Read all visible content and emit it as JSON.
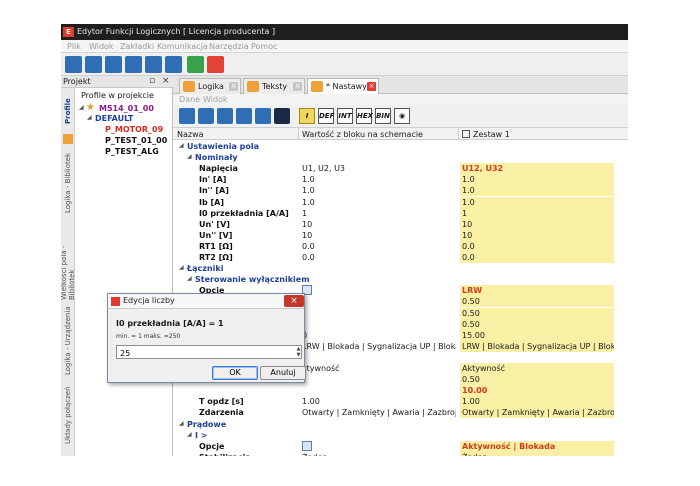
{
  "window": {
    "title": "Edytor Funkcji Logicznych [ Licencja producenta ]"
  },
  "menu": [
    "Plik",
    "Widok",
    "Zakładki",
    "Komunikacja",
    "Narzędzia",
    "Pomoc"
  ],
  "left_panel": {
    "title": "Projekt",
    "section": "Profile w projekcie",
    "vertical_tabs": [
      "Profile",
      "Logika - Bibliotek",
      "Wielkości pola - Bibliotek",
      "Logika - Urządzenia",
      "Układy połączeń"
    ],
    "tree": [
      {
        "label": "M514_01_00",
        "color": "#8b1a8b"
      },
      {
        "label": "DEFAULT",
        "color": "#1f3f99"
      },
      {
        "label": "P_MOTOR_09",
        "color": "#d52b1e"
      },
      {
        "label": "P_TEST_01_00",
        "color": "#111111"
      },
      {
        "label": "P_TEST_ALG",
        "color": "#111111"
      }
    ]
  },
  "doc_tabs": [
    {
      "label": "Logika",
      "active": false
    },
    {
      "label": "Teksty",
      "active": false
    },
    {
      "label": "* Nastawy",
      "active": true
    }
  ],
  "submenu": [
    "Dane",
    "Widok"
  ],
  "format_buttons": [
    "I",
    "DEF",
    "INT",
    "HEX",
    "BIN"
  ],
  "grid": {
    "columns": [
      "Nazwa",
      "Wartość z bloku na schemacie",
      "Zestaw 1"
    ],
    "rows": [
      {
        "level": 0,
        "name": "Ustawienia pola",
        "kind": "group"
      },
      {
        "level": 1,
        "name": "Nominały",
        "kind": "group"
      },
      {
        "level": 2,
        "name": "Napięcia",
        "value": "U1, U2, U3",
        "set": "U12, U32",
        "changed": true
      },
      {
        "level": 2,
        "name": "In' [A]",
        "value": "1.0",
        "set": "1.0"
      },
      {
        "level": 2,
        "name": "In'' [A]",
        "value": "1.0",
        "set": "1.0"
      },
      {
        "level": 2,
        "name": "Ib [A]",
        "value": "1.0",
        "set": "1.0"
      },
      {
        "level": 2,
        "name": "I0 przekładnia [A/A]",
        "value": "1",
        "set": "1"
      },
      {
        "level": 2,
        "name": "Un' [V]",
        "value": "10",
        "set": "10"
      },
      {
        "level": 2,
        "name": "Un'' [V]",
        "value": "10",
        "set": "10"
      },
      {
        "level": 2,
        "name": "RT1 [Ω]",
        "value": "0.0",
        "set": "0.0"
      },
      {
        "level": 2,
        "name": "RT2 [Ω]",
        "value": "0.0",
        "set": "0.0"
      },
      {
        "level": 0,
        "name": "Łączniki",
        "kind": "group"
      },
      {
        "level": 1,
        "name": "Sterowanie wyłącznikiem",
        "kind": "group"
      },
      {
        "level": 2,
        "name": "Opcje",
        "icon": true,
        "set": "LRW",
        "changed": true
      },
      {
        "level": 2,
        "name": "",
        "value": "",
        "set": "0.50"
      },
      {
        "level": 2,
        "name": "",
        "value": "",
        "set": "0.50"
      },
      {
        "level": 2,
        "name": "",
        "value": "",
        "set": "0.50"
      },
      {
        "level": 2,
        "name": "",
        "value": "0",
        "set": "15.00"
      },
      {
        "level": 2,
        "name": "",
        "value": "LRW | Blokada | Sygnalizacja UP | Blokada zał...",
        "set": "LRW | Blokada | Sygnalizacja UP | Blokada zał..."
      },
      {
        "level": 2,
        "name": "",
        "value": "",
        "set": ""
      },
      {
        "level": 2,
        "name": "",
        "value": "ktywność",
        "set": "Aktywność"
      },
      {
        "level": 2,
        "name": "",
        "value": "",
        "set": "0.50"
      },
      {
        "level": 2,
        "name": "",
        "value": "",
        "set": "10.00",
        "changed": true
      },
      {
        "level": 2,
        "name": "T opdz [s]",
        "value": "1.00",
        "set": "1.00"
      },
      {
        "level": 2,
        "name": "Zdarzenia",
        "value": "Otwarty | Zamknięty | Awaria | Zazbrojony | ...",
        "set": "Otwarty | Zamknięty | Awaria | Zazbrojony | ..."
      },
      {
        "level": 0,
        "name": "Prądowe",
        "kind": "group"
      },
      {
        "level": 1,
        "name": "I >",
        "kind": "group"
      },
      {
        "level": 2,
        "name": "Opcje",
        "icon": true,
        "set": "Aktywność | Blokada",
        "changed": true
      },
      {
        "level": 2,
        "name": "Stabilizacja",
        "value": "Żaden",
        "set": "Żaden"
      }
    ]
  },
  "dialog": {
    "title": "Edycja liczby",
    "label": "I0 przekładnia [A/A] = 1",
    "range": "min. = 1  maks. =250",
    "input_value": "25",
    "ok": "OK",
    "cancel": "Anuluj"
  }
}
